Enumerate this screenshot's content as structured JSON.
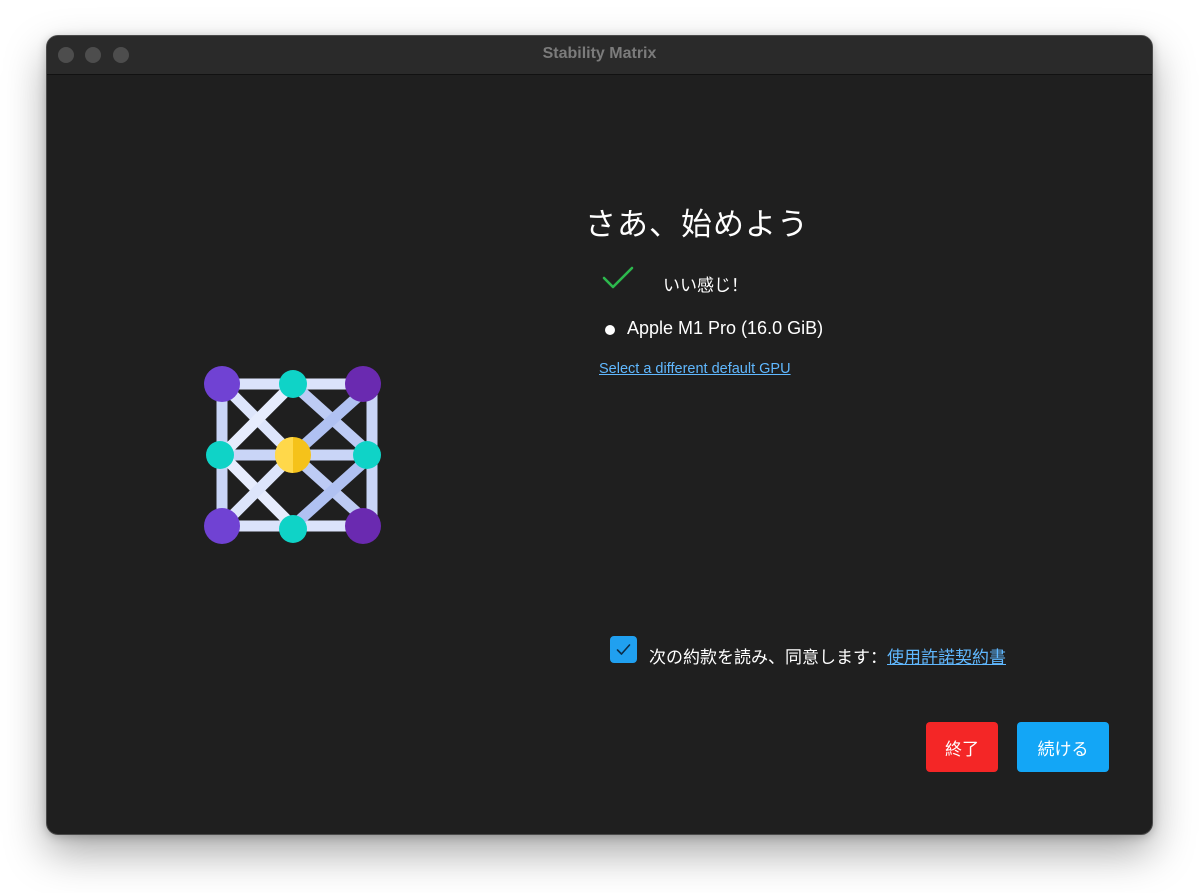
{
  "window": {
    "title": "Stability Matrix"
  },
  "welcome": {
    "heading": "さあ、始めよう",
    "status_icon": "check-icon",
    "status_text": "いい感じ！",
    "gpu_name": "Apple M1 Pro (16.0 GiB)",
    "gpu_link": "Select a different default GPU"
  },
  "license": {
    "checked": true,
    "text": "次の約款を読み、同意します：",
    "link": "使用許諾契約書"
  },
  "buttons": {
    "quit_label": "終了",
    "continue_label": "続ける"
  },
  "colors": {
    "window_bg": "#1f1f1f",
    "accent": "#13a6f6",
    "danger": "#f42626",
    "link": "#60b8ff",
    "success": "#2db84d"
  }
}
